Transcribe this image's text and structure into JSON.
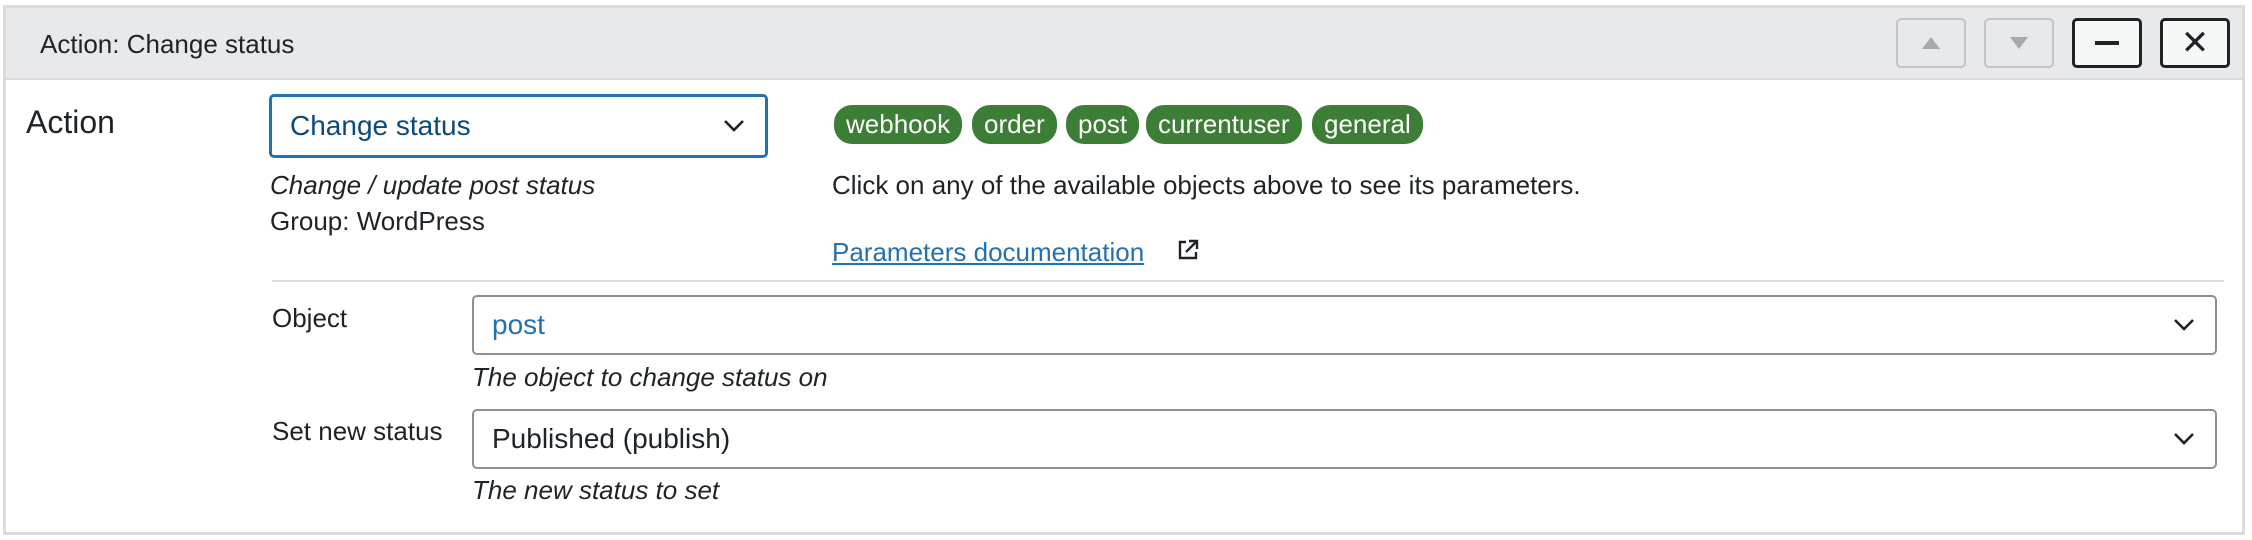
{
  "panel": {
    "title": "Action: Change status",
    "controls": {
      "move_up_icon": "triangle-up-icon",
      "move_down_icon": "triangle-down-icon",
      "minimize_icon": "minus-icon",
      "close_icon": "close-icon"
    }
  },
  "action": {
    "label": "Action",
    "select_value": "Change status",
    "description": "Change / update post status",
    "group": "Group: WordPress"
  },
  "objects": {
    "tags": [
      "webhook",
      "order",
      "post",
      "currentuser",
      "general"
    ],
    "hint": "Click on any of the available objects above to see its parameters.",
    "doc_link": "Parameters documentation",
    "tag_color": "#3c7e35"
  },
  "fields": {
    "object": {
      "label": "Object",
      "value": "post",
      "description": "The object to change status on"
    },
    "status": {
      "label": "Set new status",
      "value": "Published (publish)",
      "description": "The new status to set"
    }
  },
  "colors": {
    "accent": "#2271b1",
    "header_bg": "#e8e9eb",
    "border": "#dcdcde"
  }
}
